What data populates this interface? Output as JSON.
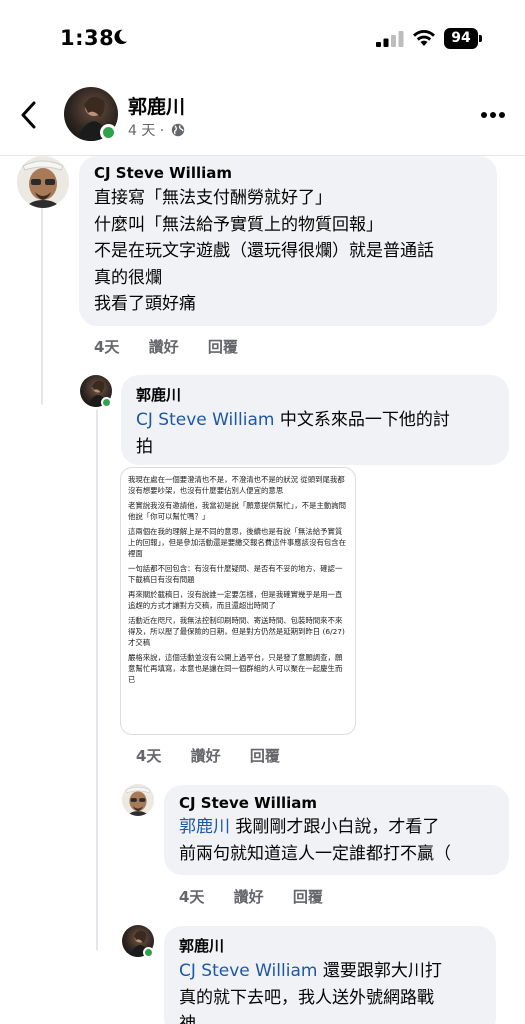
{
  "status_bar": {
    "time": "1:38",
    "battery": "94"
  },
  "header": {
    "name": "郭鹿川",
    "subtitle": "4 天 ·"
  },
  "comments": [
    {
      "author": "CJ Steve William",
      "lines": [
        "直接寫「無法支付酬勞就好了」",
        "什麼叫「無法給予實質上的物質回報」",
        "不是在玩文字遊戲（還玩得很爛）就是普通話",
        "真的很爛",
        "我看了頭好痛"
      ],
      "age": "4天",
      "like": "讚好",
      "reply": "回覆"
    },
    {
      "author": "郭鹿川",
      "mention": "CJ Steve William",
      "text_after_mention": " 中文系來品一下他的討",
      "line2": "拍",
      "age": "4天",
      "like": "讚好",
      "reply": "回覆",
      "image_text": [
        "我現在處在一個要澄清也不是，不澄清也不是的狀況 從頭到尾我都沒有想要吵架，也沒有什麼要佔別人便宜的意思",
        "老實說我沒有邀請他，我當初是說「願意提供幫忙」，不是主動詢問他說「你可以幫忙嗎？」",
        "這兩個在我的理解上是不同的意思，後續也是有說「無法給予實質上的回報」，但是參加活動還是要繳交報名費這件事應該沒有包含在裡面",
        "一句話都不回包含：有沒有什麼疑問、是否有不妥的地方、確認一下截稿日有沒有問題",
        "再來關於截稿日，沒有說誰一定要怎樣，但是我確實幾乎是用一直追趕的方式才讓對方交稿，而且還超出時間了",
        "活動近在咫尺，我無法控制印刷時間、寄送時間、包裝時間來不來得及，所以壓了最保險的日期，但是對方仍然是延期到昨日 (6/27) 才交稿",
        "嚴格來說，這個活動並沒有公開上過平台，只是發了意願調查，願意幫忙再填寫，本意也是讓在同一個群組的人可以聚在一起慶生而已"
      ]
    },
    {
      "author": "CJ Steve William",
      "mention": "郭鹿川",
      "text_after_mention": " 我剛剛才跟小白說，才看了",
      "line2": "前兩句就知道這人一定誰都打不贏（",
      "age": "4天",
      "like": "讚好",
      "reply": "回覆"
    },
    {
      "author": "郭鹿川",
      "mention": "CJ Steve William",
      "text_after_mention": " 還要跟郭大川打",
      "line2": "真的就下去吧，我人送外號網路戰",
      "line3": "神"
    }
  ]
}
